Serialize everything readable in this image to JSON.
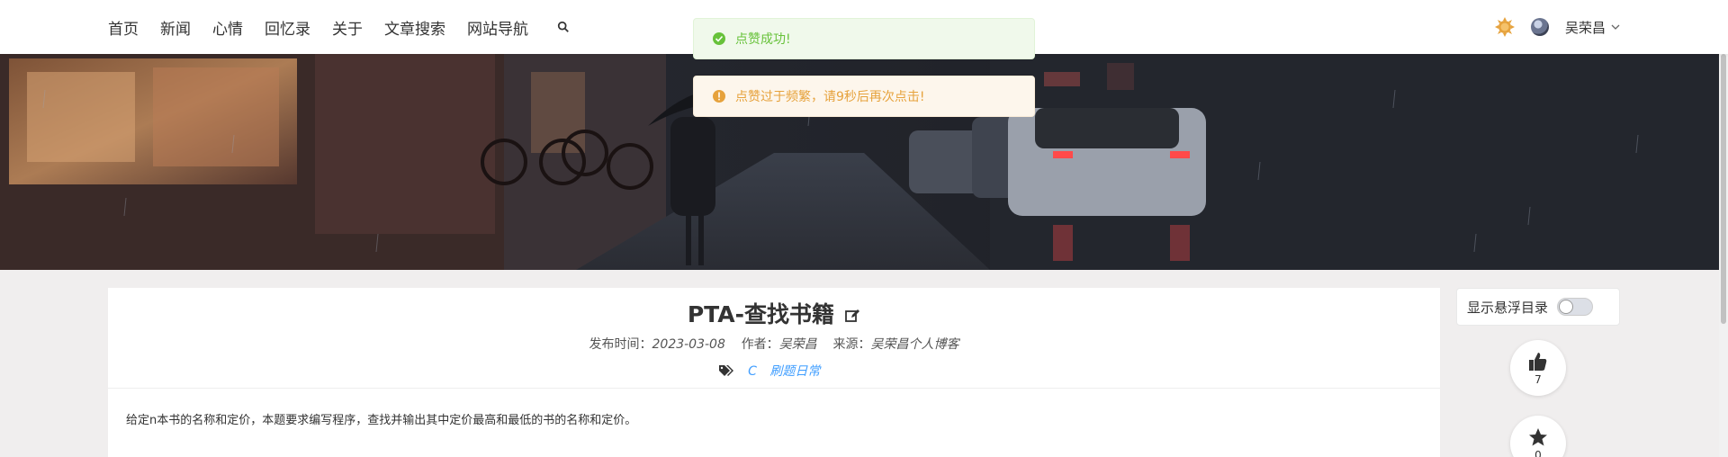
{
  "nav": {
    "items": [
      "首页",
      "新闻",
      "心情",
      "回忆录",
      "关于",
      "文章搜索",
      "网站导航"
    ],
    "search_icon": "search-icon"
  },
  "user": {
    "name": "吴荣昌",
    "theme_icon": "sun-icon"
  },
  "toasts": {
    "success": "点赞成功!",
    "warning": "点赞过于频繁，请9秒后再次点击!"
  },
  "post": {
    "title": "PTA-查找书籍",
    "meta_time_label": "发布时间：",
    "meta_time": "2023-03-08",
    "meta_author_label": "作者：",
    "meta_author": "吴荣昌",
    "meta_source_label": "来源：",
    "meta_source": "吴荣昌个人博客",
    "tags": [
      "C",
      "刷题日常"
    ],
    "content": "给定n本书的名称和定价，本题要求编写程序，查找并输出其中定价最高和最低的书的名称和定价。"
  },
  "sidebar": {
    "toc_label": "显示悬浮目录",
    "likes": "7",
    "stars": "0"
  },
  "colors": {
    "success": "#67c23a",
    "warning": "#e6a23c",
    "link": "#409eff"
  }
}
